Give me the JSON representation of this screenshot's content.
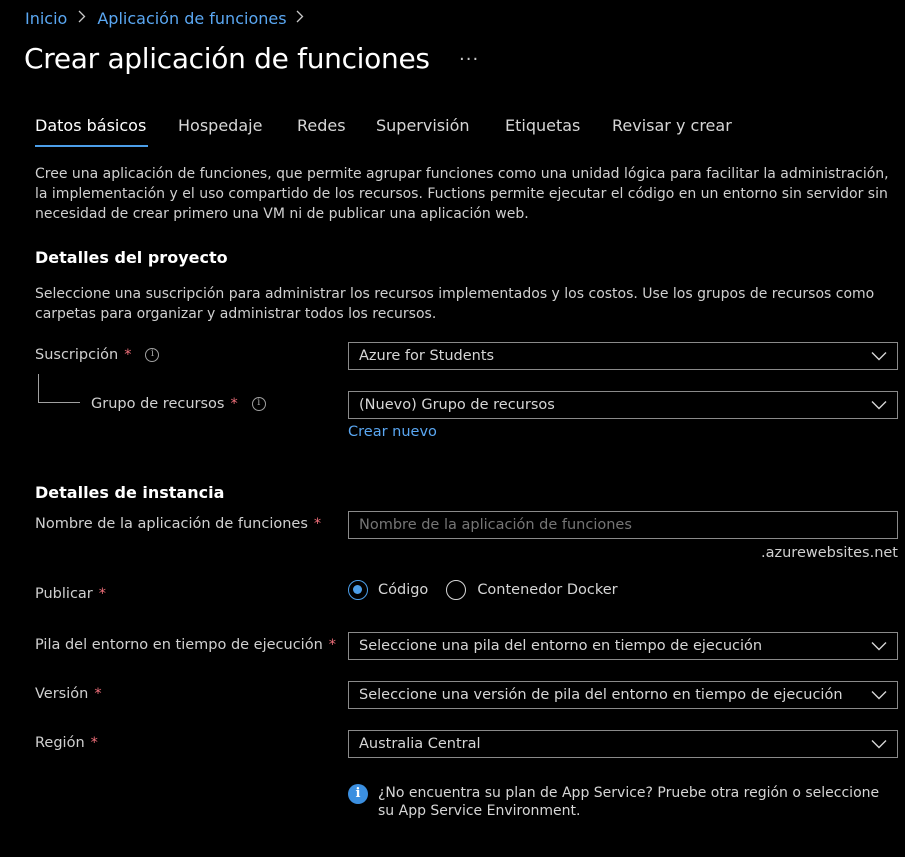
{
  "breadcrumb": {
    "items": [
      "Inicio",
      "Aplicación de funciones"
    ]
  },
  "page": {
    "title": "Crear aplicación de funciones",
    "more_label": "···"
  },
  "tabs": [
    {
      "label": "Datos básicos",
      "active": true
    },
    {
      "label": "Hospedaje"
    },
    {
      "label": "Redes"
    },
    {
      "label": "Supervisión"
    },
    {
      "label": "Etiquetas"
    },
    {
      "label": "Revisar y crear"
    }
  ],
  "intro": {
    "text": "Cree una aplicación de funciones, que permite agrupar funciones como una unidad lógica para facilitar la administración, la implementación y el uso compartido de los recursos. Fuctions permite ejecutar el código en un entorno sin servidor sin necesidad de crear primero una VM ni de publicar una aplicación web."
  },
  "project": {
    "heading": "Detalles del proyecto",
    "description": "Seleccione una suscripción para administrar los recursos implementados y los costos. Use los grupos de recursos como carpetas para organizar y administrar todos los recursos.",
    "subscription_label": "Suscripción",
    "subscription_value": "Azure for Students",
    "resource_group_label": "Grupo de recursos",
    "resource_group_value": "(Nuevo) Grupo de recursos",
    "create_new_link": "Crear nuevo"
  },
  "instance": {
    "heading": "Detalles de instancia",
    "app_name_label": "Nombre de la aplicación de funciones",
    "app_name_placeholder": "Nombre de la aplicación de funciones",
    "app_name_value": "",
    "domain_suffix": ".azurewebsites.net",
    "publish_label": "Publicar",
    "publish_options": [
      {
        "label": "Código",
        "selected": true
      },
      {
        "label": "Contenedor Docker",
        "selected": false
      }
    ],
    "runtime_label": "Pila del entorno en tiempo de ejecución",
    "runtime_placeholder": "Seleccione una pila del entorno en tiempo de ejecución",
    "version_label": "Versión",
    "version_placeholder": "Seleccione una versión de pila del entorno en tiempo de ejecución",
    "region_label": "Región",
    "region_value": "Australia Central",
    "notice_text": "¿No encuentra su plan de App Service? Pruebe otra región o seleccione su App Service Environment."
  },
  "required_marker": "*",
  "colors": {
    "background": "#000000",
    "accent": "#4c9ee8",
    "link": "#5aa7f2",
    "required": "#f1707b",
    "border": "#8a8a8a"
  }
}
